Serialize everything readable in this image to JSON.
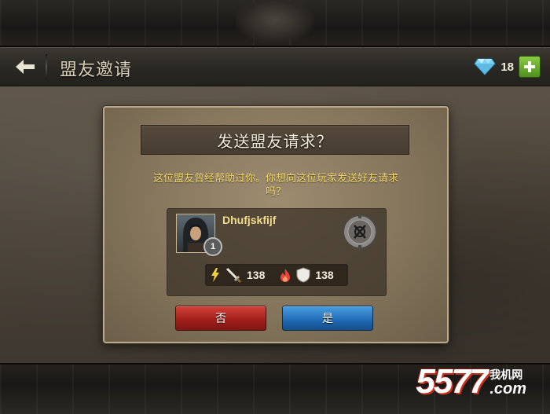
{
  "header": {
    "title": "盟友邀请",
    "gem_count": "18"
  },
  "dialog": {
    "title": "发送盟友请求？",
    "message": "这位盟友曾经帮助过你。你想向这位玩家发送好友请求吗？",
    "player": {
      "name": "Dhufjskfijf",
      "level": "1",
      "attack": "138",
      "defense": "138"
    },
    "no_label": "否",
    "yes_label": "是"
  },
  "watermark": {
    "number": "5577",
    "cn": "我机网",
    "domain": ".com"
  },
  "icons": {
    "back": "back-arrow-icon",
    "gem": "diamond-gem-icon",
    "add": "plus-icon",
    "lightning": "lightning-icon",
    "sword": "sword-icon",
    "flame": "flame-icon",
    "shield": "shield-icon",
    "guild": "guild-emblem-icon"
  },
  "colors": {
    "no_button": "#b62a23",
    "yes_button": "#2a7ac8",
    "message_text": "#f2d76a",
    "player_name": "#f4dd8a"
  }
}
